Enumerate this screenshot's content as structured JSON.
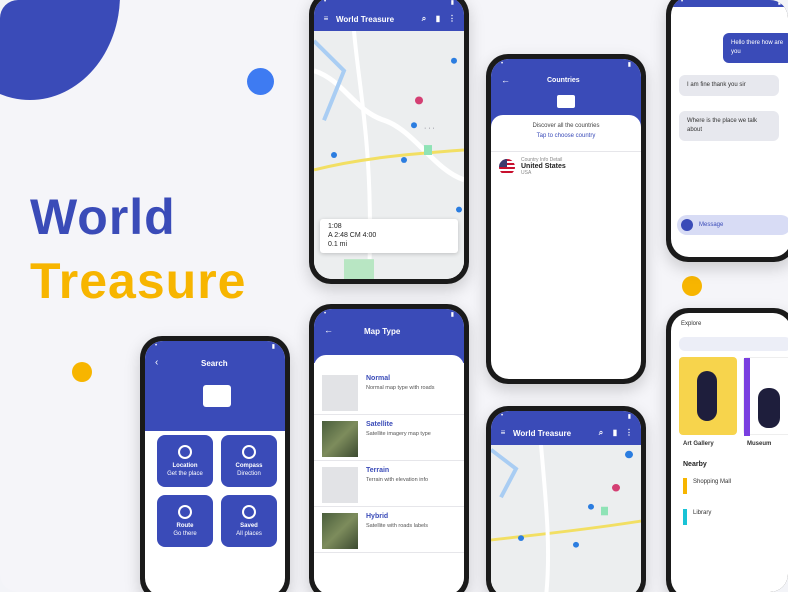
{
  "brand": {
    "line1": "World",
    "line2": "Treasure"
  },
  "map_top": {
    "title": "World Treasure",
    "card_time": "1:08",
    "card_line1": "A 2:48 CM 4:00",
    "card_line2": "0.1 mi"
  },
  "search_phone": {
    "title": "Search",
    "tiles": [
      {
        "label": "Location",
        "sub": "Get the place"
      },
      {
        "label": "Compass",
        "sub": "Direction"
      },
      {
        "label": "Route",
        "sub": "Go there"
      },
      {
        "label": "Saved",
        "sub": "All places"
      }
    ]
  },
  "list_phone": {
    "title": "Map Type",
    "items": [
      {
        "title": "Normal",
        "sub": "Normal map type with roads"
      },
      {
        "title": "Satellite",
        "sub": "Satellite imagery map type"
      },
      {
        "title": "Terrain",
        "sub": "Terrain with elevation info"
      },
      {
        "title": "Hybrid",
        "sub": "Satellite with roads labels"
      }
    ]
  },
  "country_phone": {
    "title": "Countries",
    "subtitle": "Discover all the countries",
    "link": "Tap to choose country",
    "item_title": "United States",
    "item_sub": "Country Info Detail",
    "item_meta": "USA"
  },
  "map_bottom": {
    "title": "World Treasure"
  },
  "chat_phone": {
    "out1": "Hello there how are you",
    "in1": "I am fine thank you sir",
    "in2": "Where is the place we talk about",
    "input": "Message"
  },
  "places_phone": {
    "tab": "Explore",
    "card1": "Art Gallery",
    "card2": "Museum",
    "section": "Nearby",
    "row1": "Shopping Mall",
    "row2": "Library"
  }
}
